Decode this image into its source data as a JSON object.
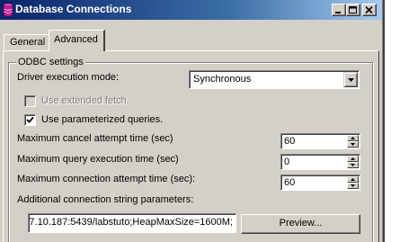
{
  "window": {
    "title": "Database Connections"
  },
  "tabs": [
    {
      "label": "General",
      "active": false
    },
    {
      "label": "Advanced",
      "active": true
    }
  ],
  "odbc": {
    "group_title": "ODBC settings",
    "driver_mode_label": "Driver execution mode:",
    "driver_mode_value": "Synchronous",
    "extended_fetch_label": "Use extended fetch.",
    "extended_fetch_checked": false,
    "parameterized_label": "Use parameterized queries.",
    "parameterized_checked": true,
    "cancel_time_label": "Maximum cancel attempt time (sec)",
    "cancel_time_value": "60",
    "query_time_label": "Maximum query execution time (sec)",
    "query_time_value": "0",
    "connection_time_label": "Maximum connection attempt time (sec):",
    "connection_time_value": "60",
    "additional_params_label": "Additional connection string parameters:",
    "additional_params_value": "7.10.187:5439/labstuto;HeapMaxSize=1600M;",
    "preview_button": "Preview..."
  },
  "colors": {
    "titlebar_start": "#0a246a",
    "titlebar_end": "#a6caf0",
    "face": "#d4d0c8"
  }
}
